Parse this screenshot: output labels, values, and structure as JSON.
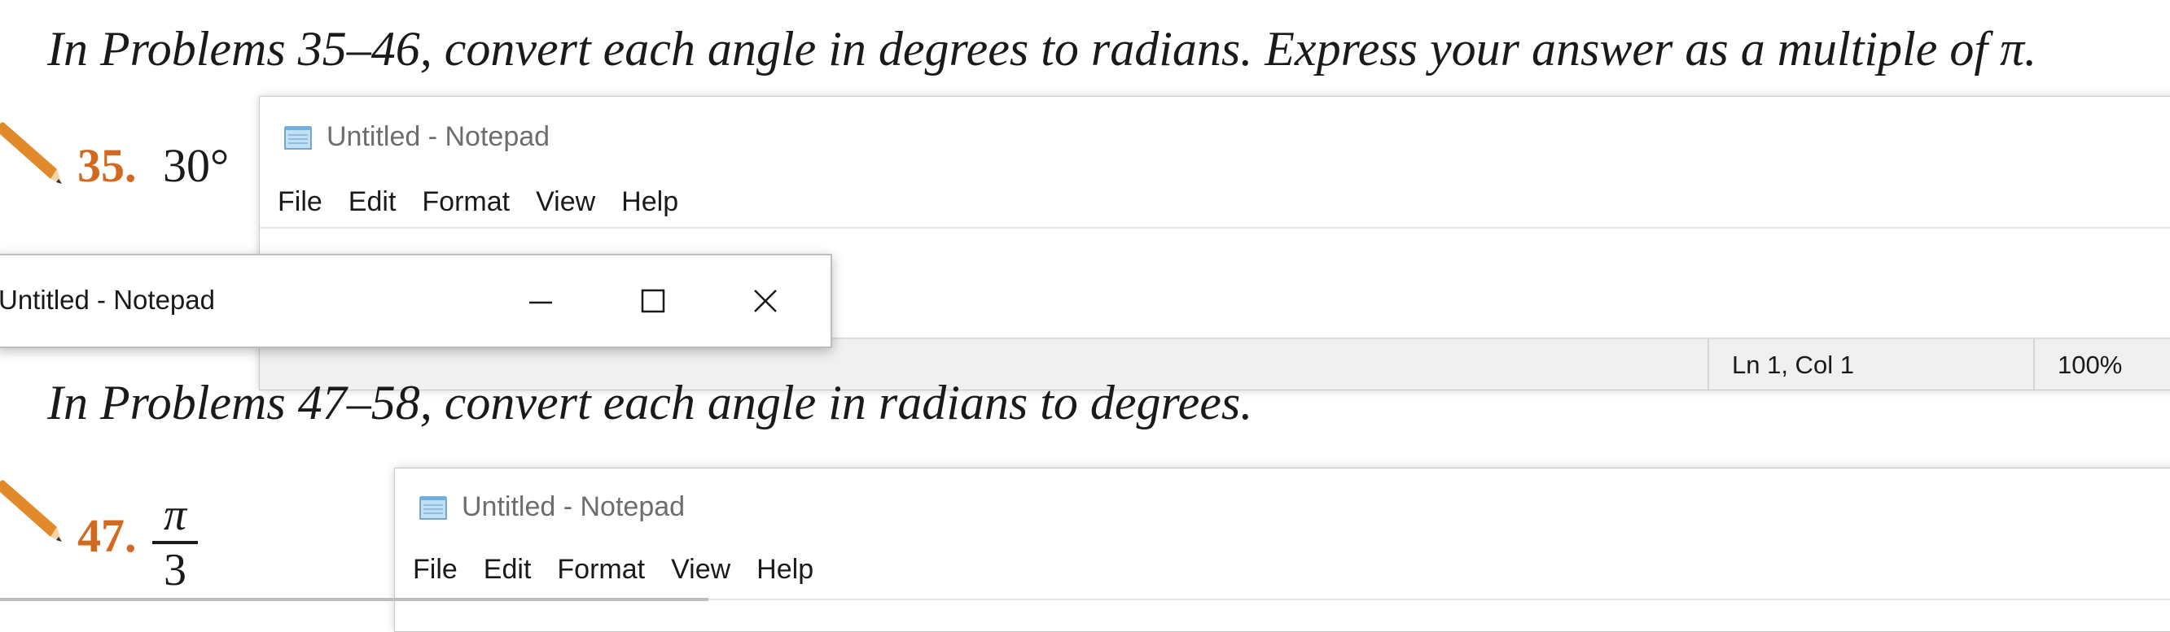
{
  "heading_1": "In Problems 35–46, convert each angle in degrees to radians. Express your answer as a multiple of π.",
  "heading_2": "In Problems 47–58, convert each angle in radians to degrees.",
  "problem_35": {
    "number": "35.",
    "value": "30°"
  },
  "problem_47": {
    "number": "47.",
    "numerator": "π",
    "denominator": "3"
  },
  "notepad_1": {
    "title": "Untitled - Notepad",
    "menu": [
      "File",
      "Edit",
      "Format",
      "View",
      "Help"
    ],
    "status_position": "Ln 1, Col 1",
    "status_zoom": "100%"
  },
  "taskbar_preview": {
    "title": "Untitled - Notepad"
  },
  "notepad_2": {
    "title": "Untitled - Notepad",
    "menu": [
      "File",
      "Edit",
      "Format",
      "View",
      "Help"
    ]
  },
  "colors": {
    "problem_number": "#d2691e",
    "status_bar": "#f0f0f0",
    "pencil": "#e08a2c"
  },
  "icons": [
    "pencil-icon",
    "notepad-icon",
    "minimize-icon",
    "maximize-icon",
    "close-icon"
  ]
}
